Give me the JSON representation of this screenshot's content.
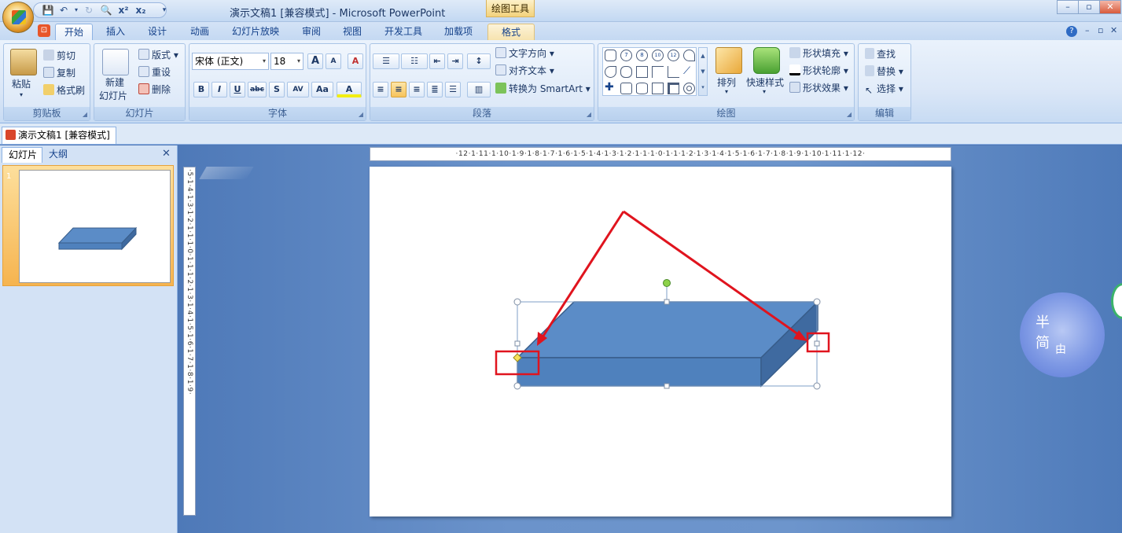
{
  "window": {
    "title": "演示文稿1 [兼容模式] - Microsoft PowerPoint",
    "context_tab": "绘图工具",
    "controls": {
      "minimize": "–",
      "restore": "▫",
      "close": "✕"
    }
  },
  "quick_access": [
    "save-icon",
    "undo-icon",
    "redo-icon",
    "print-preview-icon",
    "superscript-icon",
    "subscript-icon",
    "customize-icon"
  ],
  "qat_labels": {
    "superscript": "x²",
    "subscript": "x₂"
  },
  "tabs": [
    {
      "label": "开始",
      "active": true
    },
    {
      "label": "插入"
    },
    {
      "label": "设计"
    },
    {
      "label": "动画"
    },
    {
      "label": "幻灯片放映"
    },
    {
      "label": "审阅"
    },
    {
      "label": "视图"
    },
    {
      "label": "开发工具"
    },
    {
      "label": "加载项"
    },
    {
      "label": "格式",
      "contextual": true
    }
  ],
  "ribbon": {
    "clipboard": {
      "title": "剪贴板",
      "paste": "粘贴",
      "cut": "剪切",
      "copy": "复制",
      "format_painter": "格式刷"
    },
    "slides": {
      "title": "幻灯片",
      "new_slide_1": "新建",
      "new_slide_2": "幻灯片",
      "layout": "版式",
      "reset": "重设",
      "delete": "删除"
    },
    "font": {
      "title": "字体",
      "font_name": "宋体 (正文)",
      "font_size": "18",
      "grow": "A",
      "shrink": "A",
      "clear": "A",
      "bold": "B",
      "italic": "I",
      "underline": "U",
      "strike": "abc",
      "shadow": "S",
      "spacing": "AV",
      "case": "Aa",
      "color": "A"
    },
    "paragraph": {
      "title": "段落",
      "text_direction": "文字方向",
      "align_text": "对齐文本",
      "convert_smartart": "转换为 SmartArt"
    },
    "drawing": {
      "title": "绘图",
      "arrange": "排列",
      "quick_styles": "快速样式",
      "shape_fill": "形状填充",
      "shape_outline": "形状轮廓",
      "shape_effects": "形状效果",
      "shapes_row1": [
        "8",
        "10",
        "12"
      ]
    },
    "editing": {
      "title": "编辑",
      "find": "查找",
      "replace": "替换",
      "select": "选择"
    }
  },
  "document_tab": "演示文稿1 [兼容模式]",
  "pane_tabs": {
    "slides": "幻灯片",
    "outline": "大纲",
    "close": "✕"
  },
  "thumbnail": {
    "number": "1"
  },
  "rulers": {
    "horizontal": "·12·1·11·1·10·1·9·1·8·1·7·1·6·1·5·1·4·1·3·1·2·1·1·1·0·1·1·1·2·1·3·1·4·1·5·1·6·1·7·1·8·1·9·1·10·1·11·1·12·",
    "vertical": "·5·1·4·1·3·1·2·1·1·1·0·1·1·1·2·1·3·1·4·1·5·1·6·1·7·1·8·1·9·"
  },
  "colors": {
    "shape_front": "#4f81bd",
    "shape_top": "#5b8cc7",
    "shape_side": "#3f6aa0",
    "shape_stroke": "#385d8a",
    "annotation": "#e0141e",
    "handle_yellow": "#f6e05a",
    "rotate_green": "#8dd24a"
  },
  "watermark": {
    "chars": "半 简",
    "sub": "由"
  }
}
